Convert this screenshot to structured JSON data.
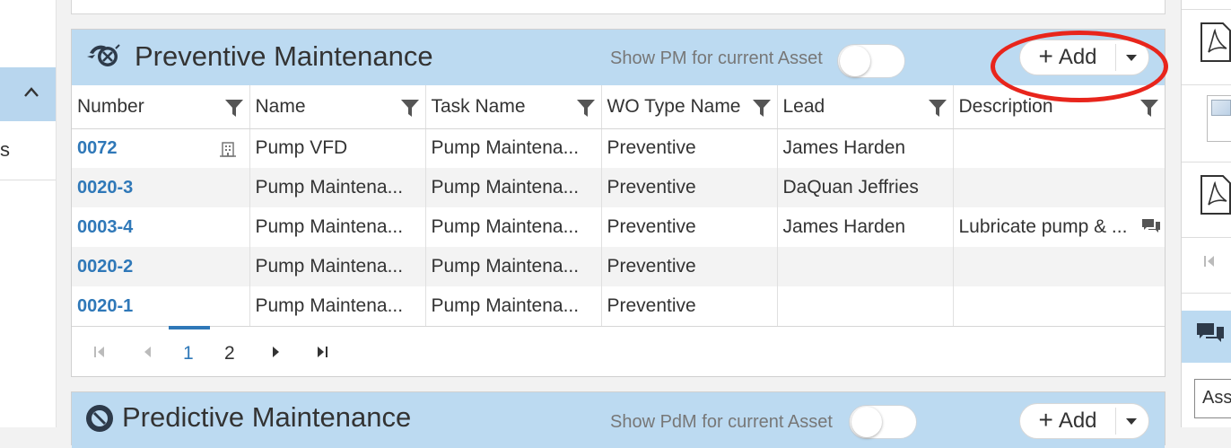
{
  "left_nav": {
    "fragment_text": "s"
  },
  "pm_panel": {
    "title": "Preventive Maintenance",
    "toggle_label": "Show PM for current Asset",
    "toggle_on": false,
    "add_label": "Add",
    "columns": [
      "Number",
      "Name",
      "Task Name",
      "WO Type Name",
      "Lead",
      "Description"
    ],
    "rows": [
      {
        "number": "0072",
        "name": "Pump VFD",
        "task_name": "Pump Maintena...",
        "wo_type": "Preventive",
        "lead": "James Harden",
        "description": "",
        "has_building_icon": true,
        "has_comment_icon": false
      },
      {
        "number": "0020-3",
        "name": "Pump Maintena...",
        "task_name": "Pump Maintena...",
        "wo_type": "Preventive",
        "lead": "DaQuan Jeffries",
        "description": "",
        "has_building_icon": false,
        "has_comment_icon": false
      },
      {
        "number": "0003-4",
        "name": "Pump Maintena...",
        "task_name": "Pump Maintena...",
        "wo_type": "Preventive",
        "lead": "James Harden",
        "description": "Lubricate pump & ...",
        "has_building_icon": false,
        "has_comment_icon": true
      },
      {
        "number": "0020-2",
        "name": "Pump Maintena...",
        "task_name": "Pump Maintena...",
        "wo_type": "Preventive",
        "lead": "",
        "description": "",
        "has_building_icon": false,
        "has_comment_icon": false
      },
      {
        "number": "0020-1",
        "name": "Pump Maintena...",
        "task_name": "Pump Maintena...",
        "wo_type": "Preventive",
        "lead": "",
        "description": "",
        "has_building_icon": false,
        "has_comment_icon": false
      }
    ],
    "pager": {
      "pages": [
        "1",
        "2"
      ],
      "current_page": "1"
    }
  },
  "pdm_panel": {
    "title": "Predictive Maintenance",
    "toggle_label": "Show PdM for current Asset",
    "add_label": "Add"
  },
  "right_panel": {
    "input_text": "Ass"
  },
  "annotation": {
    "color": "#e8251c",
    "target": "add-button"
  },
  "colors": {
    "header_bg": "#bcdaf1",
    "link": "#2f78b8"
  },
  "icons": [
    "pm-logo-icon",
    "filter-icon",
    "building-icon",
    "comment-icon",
    "pdf-icon",
    "chat-icon",
    "chevron-up-icon"
  ]
}
